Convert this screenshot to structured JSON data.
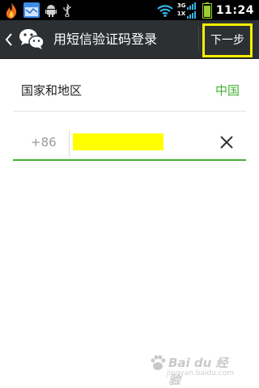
{
  "status_bar": {
    "time": "11:24",
    "network_4g": "3G",
    "network_1x": "1X",
    "icons": [
      "flame-icon",
      "calendar-app-icon",
      "android-debug-icon",
      "usb-icon",
      "wifi-icon",
      "signal-3g-icon",
      "signal-1x-icon",
      "battery-icon"
    ]
  },
  "header": {
    "title": "用短信验证码登录",
    "next_label": "下一步",
    "back_icon": "chevron-left-icon",
    "logo_icon": "wechat-logo-icon"
  },
  "form": {
    "country_label": "国家和地区",
    "country_value": "中国",
    "country_code": "+86",
    "phone_value": "",
    "clear_icon": "clear-x-icon"
  },
  "watermark": {
    "brand": "Bai du 经验",
    "url": "jingyan.baidu.com"
  },
  "colors": {
    "accent_green": "#45b035",
    "highlight_yellow": "#f5ee00",
    "redaction_yellow": "#ffff00",
    "titlebar": "#2d3033"
  }
}
